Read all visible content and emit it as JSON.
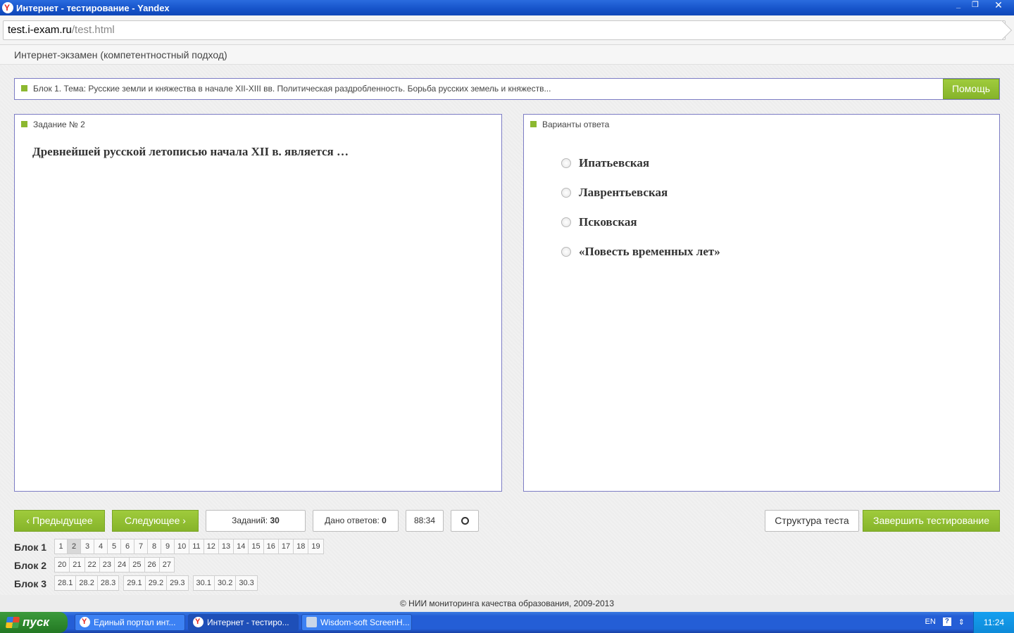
{
  "window": {
    "title": "Интернет - тестирование - Yandex",
    "min": "_",
    "max": "❐",
    "close": "✕"
  },
  "address": {
    "host": "test.i-exam.ru",
    "path": "/test.html"
  },
  "exam_header": "Интернет-экзамен (компетентностный подход)",
  "block_bar": {
    "text": "Блок 1. Тема: Русские земли и княжества в начале XII-XIII вв. Политическая раздробленность. Борьба русских земель и княжеств...",
    "help": "Помощь"
  },
  "question": {
    "title": "Задание № 2",
    "text": "Древнейшей русской летописью начала XII в. является …"
  },
  "answers": {
    "title": "Варианты ответа",
    "options": [
      "Ипатьевская",
      "Лаврентьевская",
      "Псковская",
      "«Повесть временных лет»"
    ]
  },
  "nav": {
    "prev": "Предыдущее",
    "next": "Следующее",
    "tasks_label": "Заданий:",
    "tasks_value": "30",
    "answered_label": "Дано ответов:",
    "answered_value": "0",
    "timer": "88:34",
    "structure": "Структура теста",
    "finish": "Завершить тестирование"
  },
  "blocks": [
    {
      "label": "Блок 1",
      "groups": [
        [
          "1",
          "2",
          "3",
          "4",
          "5",
          "6",
          "7",
          "8",
          "9",
          "10",
          "11",
          "12",
          "13",
          "14",
          "15",
          "16",
          "17",
          "18",
          "19"
        ]
      ]
    },
    {
      "label": "Блок 2",
      "groups": [
        [
          "20",
          "21",
          "22",
          "23",
          "24",
          "25",
          "26",
          "27"
        ]
      ]
    },
    {
      "label": "Блок 3",
      "groups": [
        [
          "28.1",
          "28.2",
          "28.3"
        ],
        [
          "29.1",
          "29.2",
          "29.3"
        ],
        [
          "30.1",
          "30.2",
          "30.3"
        ]
      ]
    }
  ],
  "active_page": "2",
  "footer": "© НИИ мониторинга качества образования, 2009-2013",
  "taskbar": {
    "start": "пуск",
    "tasks": [
      "Единый портал инт...",
      "Интернет - тестиро...",
      "Wisdom-soft ScreenH..."
    ],
    "lang": "EN",
    "clock": "11:24"
  },
  "colors": {
    "accent_green": "#8cb830",
    "panel_border": "#7c7cc4"
  }
}
